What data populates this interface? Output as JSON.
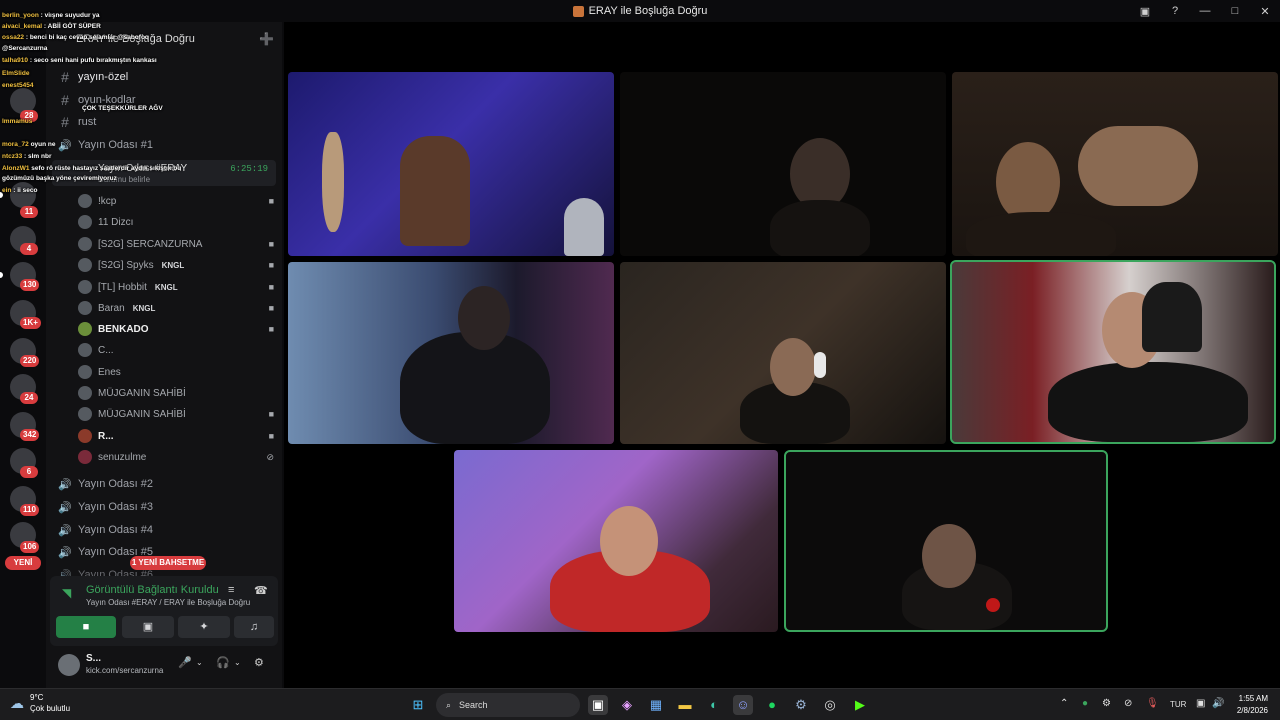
{
  "window": {
    "title": "ERAY ile Boşluğa Doğru",
    "controls": [
      "▣",
      "?",
      "—",
      "□",
      "✕"
    ]
  },
  "server": {
    "name": "ERAY ile Boşluğa Doğru"
  },
  "rail": {
    "badges": [
      "28",
      "11",
      "4",
      "130",
      "1K+",
      "220",
      "24",
      "342",
      "6",
      "110",
      "106"
    ],
    "new_label": "YENİ"
  },
  "channels": {
    "text": [
      {
        "label": "yayın-özel",
        "bold": true
      },
      {
        "label": "oyun-kodlar",
        "bold": false
      },
      {
        "label": "rust",
        "bold": false
      }
    ],
    "voice_room_1": "Yayın Odası #1",
    "live_stage": {
      "name": "Yayın Odası #ERAY",
      "status": "Durumu belirle",
      "elapsed": "6:25:19"
    },
    "voice_rooms": [
      "Yayın Odası #2",
      "Yayın Odası #3",
      "Yayın Odası #4",
      "Yayın Odası #5",
      "Yayın Odası #6"
    ]
  },
  "voice_users": [
    {
      "name": "!kcp",
      "tag": "",
      "cam": true
    },
    {
      "name": "11 Dizcı",
      "tag": "",
      "cam": false
    },
    {
      "name": "[S2G] SERCANZURNA",
      "tag": "",
      "cam": true
    },
    {
      "name": "[S2G] Spyks",
      "tag": "KNGL",
      "cam": true
    },
    {
      "name": "[TL] Hobbit",
      "tag": "KNGL",
      "cam": true
    },
    {
      "name": "Baran",
      "tag": "KNGL",
      "cam": true
    },
    {
      "name": "BENKADO",
      "tag": "",
      "cam": true
    },
    {
      "name": "C...",
      "tag": "",
      "cam": false
    },
    {
      "name": "Enes",
      "tag": "",
      "cam": false
    },
    {
      "name": "MÜJGANIN SAHİBİ",
      "tag": "",
      "cam": false
    },
    {
      "name": "MÜJGANIN SAHİBİ",
      "tag": "",
      "cam": true
    },
    {
      "name": "R...",
      "tag": "",
      "cam": true
    },
    {
      "name": "senuzulme",
      "tag": "",
      "cam": false
    }
  ],
  "mention_pill": "1 YENİ BAHSETME",
  "voice_panel": {
    "title": "Görüntülü Bağlantı Kuruldu",
    "subtitle": "Yayın Odası #ERAY / ERAY ile Boşluğa Doğru"
  },
  "user_footer": {
    "name": "S...",
    "link": "kick.com/sercanzurna"
  },
  "stream_chat": [
    {
      "user": "berlin_yoon",
      "text": "viışne suyudur ya"
    },
    {
      "user": "aivaci_kemal",
      "text": "ABİİ GÖT SÜPER"
    },
    {
      "user": "ossa22",
      "text": "benci bi kaç cevap selamlar @sabofoq"
    },
    {
      "user": "",
      "text": "@Sercanzurna"
    },
    {
      "user": "talha910",
      "text": "seco seni hani pufu bırakmıştın kankası"
    },
    {
      "user": "ElmSlide",
      "text": ""
    },
    {
      "user": "enest5454",
      "text": ""
    },
    {
      "user": "",
      "text": "ÇOK TEŞEKKÜRLER AĞV"
    },
    {
      "user": "lmmamus",
      "text": ""
    },
    {
      "user": "mora_72",
      "text": "oyun ne"
    },
    {
      "user": "ntcz33",
      "text": "slm nbr"
    },
    {
      "user": "AlonzW1",
      "text": "sefo rö rüste hastayız saatlerdir aydık sıkıştık bu"
    },
    {
      "user": "",
      "text": "gözümüzü başka yöne çeviremiyoruz"
    },
    {
      "user": "ein",
      "text": "ii seco"
    }
  ],
  "taskbar": {
    "weather_temp": "9°C",
    "weather_desc": "Çok bulutlu",
    "search_label": "Search",
    "language": "TUR",
    "time": "1:55 AM",
    "date": "2/8/2026"
  },
  "colors": {
    "accent_green": "#3ba55d",
    "alert_red": "#d83c3e",
    "sidebar_bg": "#121214"
  }
}
